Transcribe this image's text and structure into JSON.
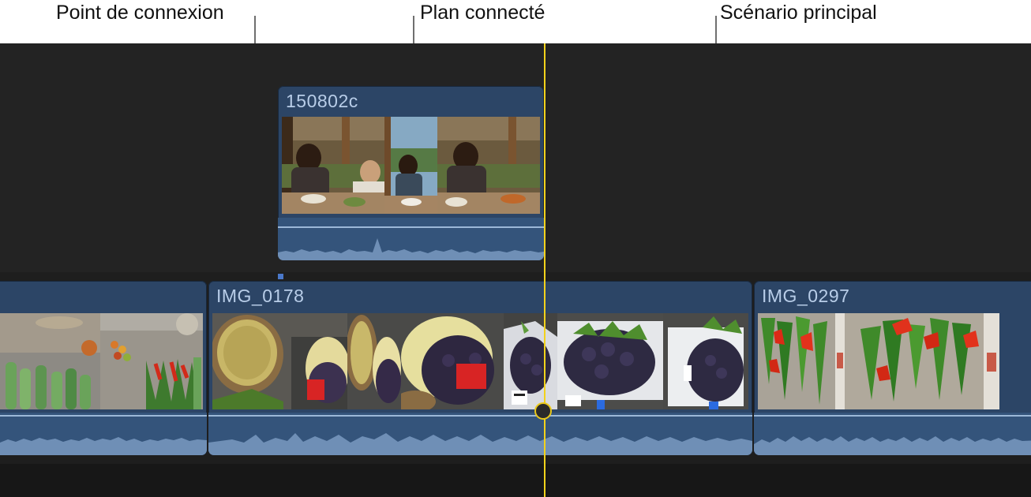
{
  "callouts": {
    "connection_point": "Point de connexion",
    "connected_clip": "Plan connecté",
    "primary_storyline": "Scénario principal"
  },
  "connected_clip": {
    "title": "150802c"
  },
  "storyline_clips": [
    {
      "title": ""
    },
    {
      "title": "IMG_0178"
    },
    {
      "title": "IMG_0297"
    }
  ],
  "colors": {
    "clip_fill": "#2c4566",
    "clip_title": "#b8cde8",
    "audio_fill": "#34547b",
    "playhead": "#f2d21b",
    "connection_point": "#4a78c9",
    "timeline_bg": "#1e1e1e"
  },
  "icons": {
    "connection_point": "connection-point-marker",
    "playhead": "playhead-knob"
  }
}
